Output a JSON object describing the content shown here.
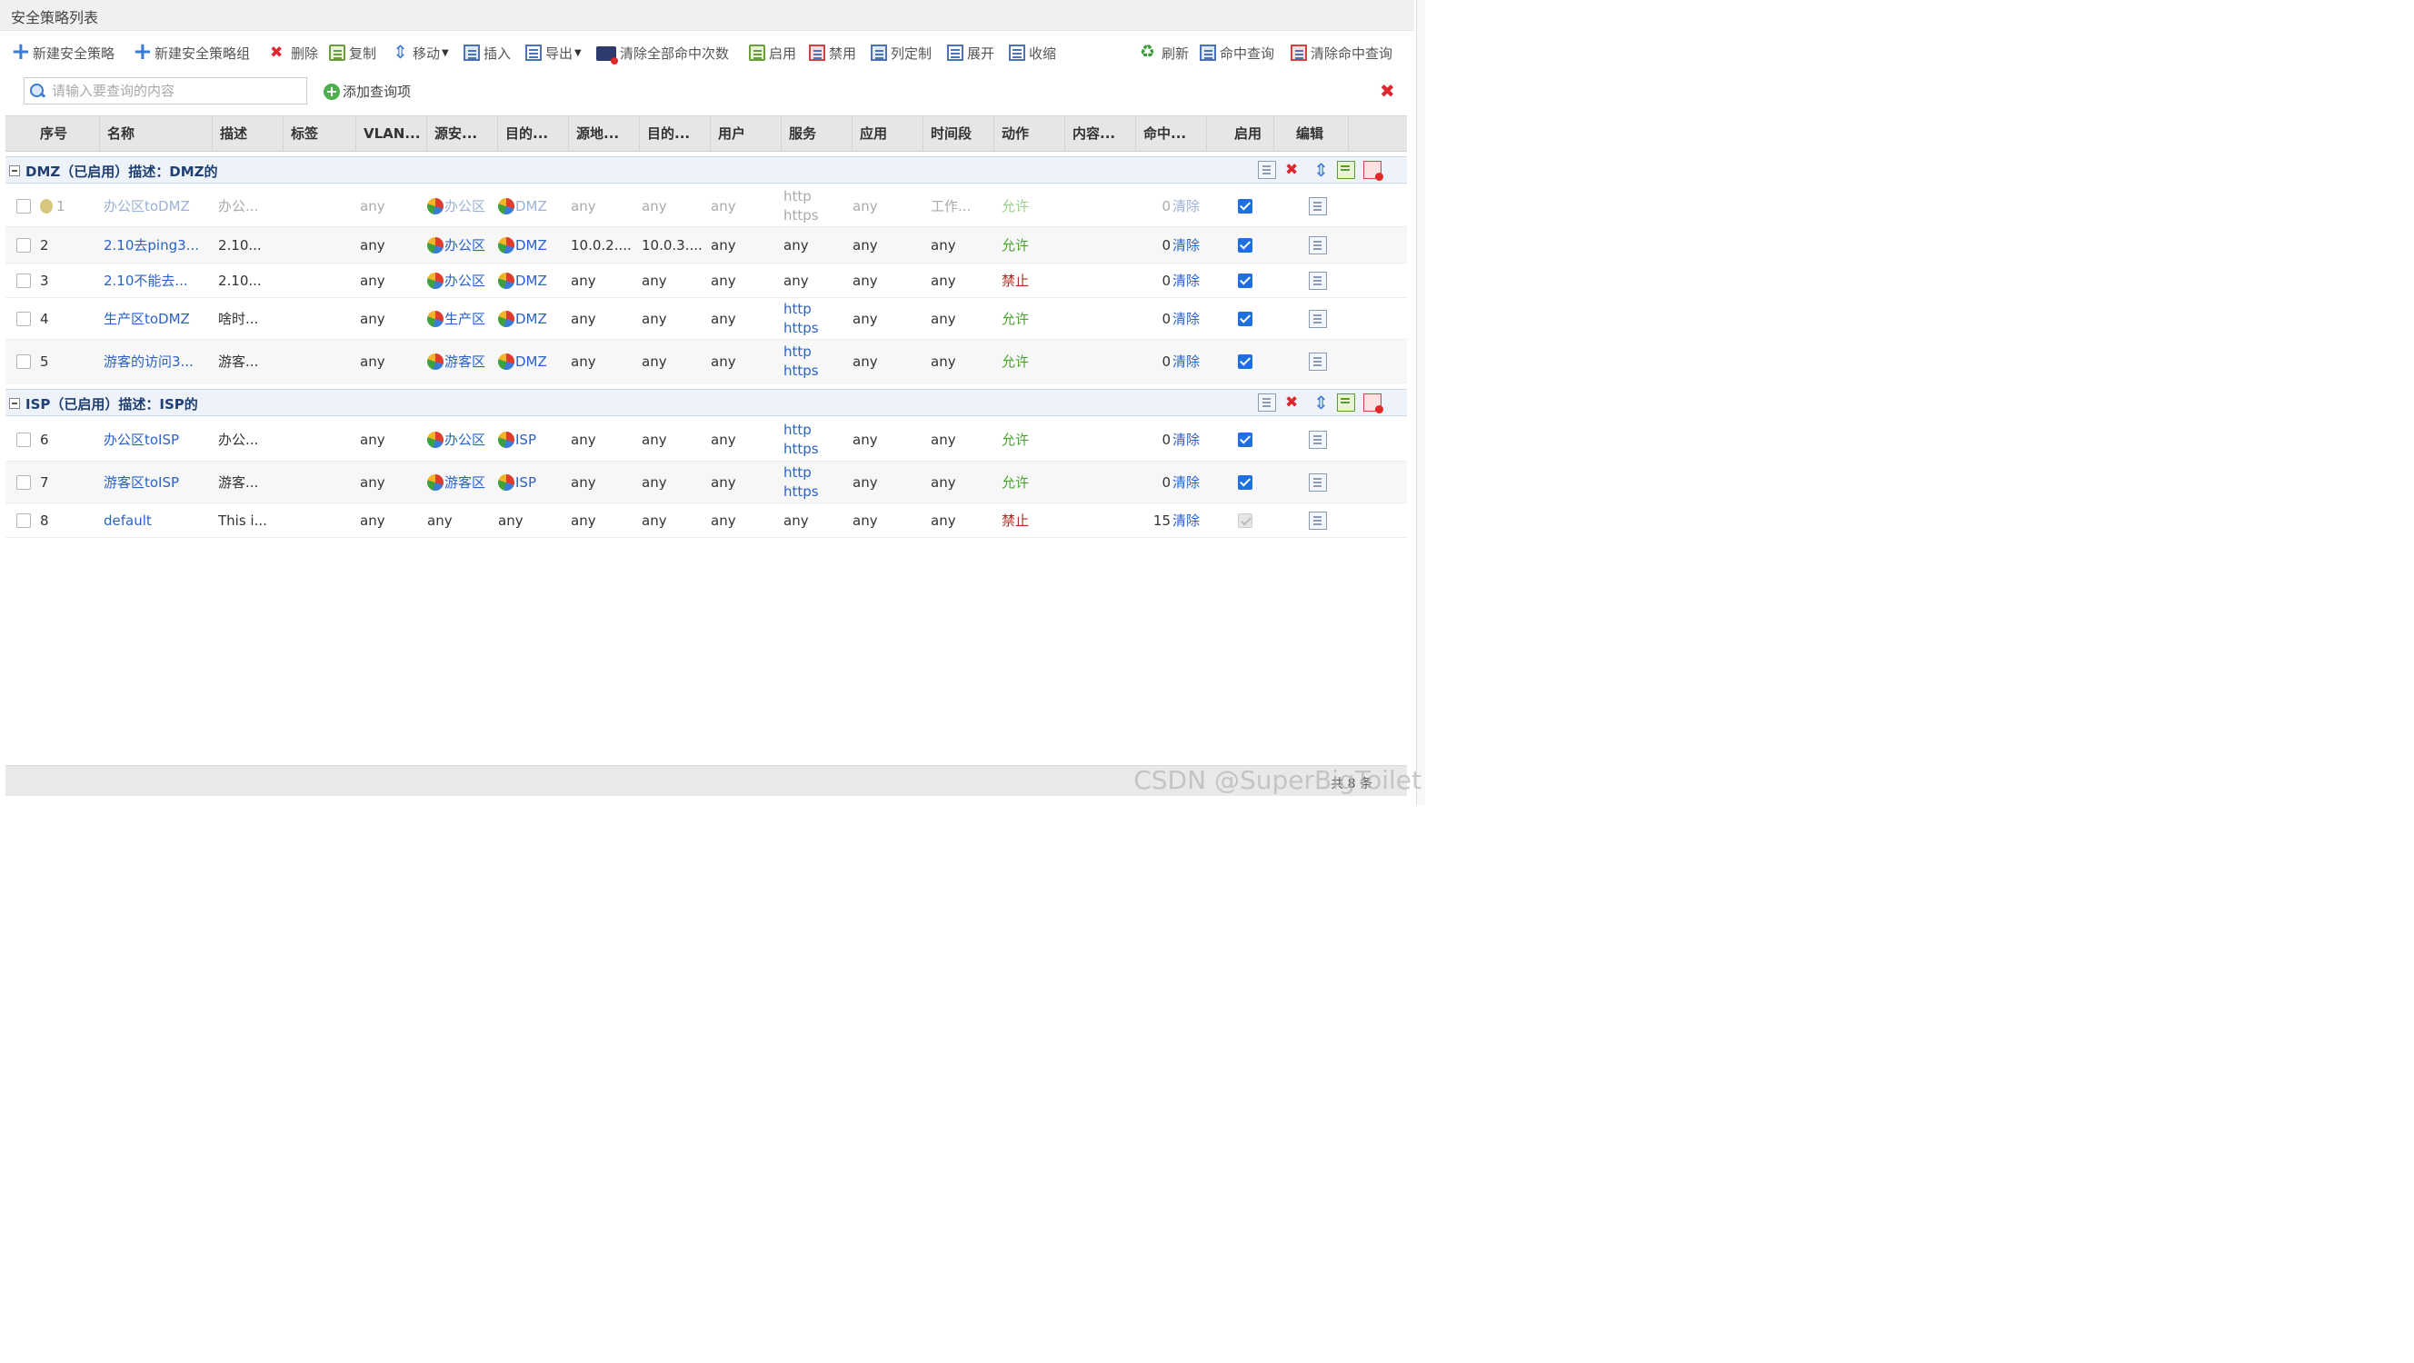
{
  "panel": {
    "title": "安全策略列表"
  },
  "toolbar": {
    "new_policy": "新建安全策略",
    "new_group": "新建安全策略组",
    "delete": "删除",
    "copy": "复制",
    "move": "移动",
    "insert": "插入",
    "export": "导出",
    "clear_all_hits": "清除全部命中次数",
    "enable": "启用",
    "disable": "禁用",
    "customize_columns": "列定制",
    "expand": "展开",
    "collapse": "收缩",
    "refresh": "刷新",
    "hit_query": "命中查询",
    "clear_hit_query": "清除命中查询"
  },
  "search": {
    "placeholder": "请输入要查询的内容",
    "add_query": "添加查询项"
  },
  "columns": [
    "序号",
    "名称",
    "描述",
    "标签",
    "VLAN...",
    "源安...",
    "目的...",
    "源地...",
    "目的...",
    "用户",
    "服务",
    "应用",
    "时间段",
    "动作",
    "内容...",
    "命中...",
    "启用",
    "编辑"
  ],
  "groups": [
    {
      "label": "DMZ（已启用）描述：DMZ的"
    },
    {
      "label": "ISP（已启用）描述：ISP的"
    }
  ],
  "rows": [
    {
      "seq": "1",
      "name": "办公区toDMZ",
      "desc": "办公...",
      "vlan": "any",
      "src_zone": "办公区",
      "dst_zone": "DMZ",
      "src_addr": "any",
      "dst_addr": "any",
      "user": "any",
      "service": [
        "http",
        "https"
      ],
      "app": "any",
      "time": "工作...",
      "action": "允许",
      "hits": "0",
      "clear": "清除",
      "enabled": true
    },
    {
      "seq": "2",
      "name": "2.10去ping3...",
      "desc": "2.10...",
      "vlan": "any",
      "src_zone": "办公区",
      "dst_zone": "DMZ",
      "src_addr": "10.0.2....",
      "dst_addr": "10.0.3....",
      "user": "any",
      "service": [
        "any"
      ],
      "app": "any",
      "time": "any",
      "action": "允许",
      "hits": "0",
      "clear": "清除",
      "enabled": true
    },
    {
      "seq": "3",
      "name": "2.10不能去...",
      "desc": "2.10...",
      "vlan": "any",
      "src_zone": "办公区",
      "dst_zone": "DMZ",
      "src_addr": "any",
      "dst_addr": "any",
      "user": "any",
      "service": [
        "any"
      ],
      "app": "any",
      "time": "any",
      "action": "禁止",
      "hits": "0",
      "clear": "清除",
      "enabled": true
    },
    {
      "seq": "4",
      "name": "生产区toDMZ",
      "desc": "啥时...",
      "vlan": "any",
      "src_zone": "生产区",
      "dst_zone": "DMZ",
      "src_addr": "any",
      "dst_addr": "any",
      "user": "any",
      "service": [
        "http",
        "https"
      ],
      "app": "any",
      "time": "any",
      "action": "允许",
      "hits": "0",
      "clear": "清除",
      "enabled": true
    },
    {
      "seq": "5",
      "name": "游客的访问3...",
      "desc": "游客...",
      "vlan": "any",
      "src_zone": "游客区",
      "dst_zone": "DMZ",
      "src_addr": "any",
      "dst_addr": "any",
      "user": "any",
      "service": [
        "http",
        "https"
      ],
      "app": "any",
      "time": "any",
      "action": "允许",
      "hits": "0",
      "clear": "清除",
      "enabled": true
    },
    {
      "seq": "6",
      "name": "办公区toISP",
      "desc": "办公...",
      "vlan": "any",
      "src_zone": "办公区",
      "dst_zone": "ISP",
      "src_addr": "any",
      "dst_addr": "any",
      "user": "any",
      "service": [
        "http",
        "https"
      ],
      "app": "any",
      "time": "any",
      "action": "允许",
      "hits": "0",
      "clear": "清除",
      "enabled": true
    },
    {
      "seq": "7",
      "name": "游客区toISP",
      "desc": "游客...",
      "vlan": "any",
      "src_zone": "游客区",
      "dst_zone": "ISP",
      "src_addr": "any",
      "dst_addr": "any",
      "user": "any",
      "service": [
        "http",
        "https"
      ],
      "app": "any",
      "time": "any",
      "action": "允许",
      "hits": "0",
      "clear": "清除",
      "enabled": true
    },
    {
      "seq": "8",
      "name": "default",
      "desc": "This i...",
      "vlan": "any",
      "src_zone": "any",
      "dst_zone": "any",
      "src_addr": "any",
      "dst_addr": "any",
      "user": "any",
      "service": [
        "any"
      ],
      "app": "any",
      "time": "any",
      "action": "禁止",
      "hits": "15",
      "clear": "清除",
      "enabled": false
    }
  ],
  "footer": {
    "summary": "共 8 条"
  },
  "watermark": "CSDN @SuperBigToilet",
  "colors": {
    "accent": "#2a62c9",
    "allow": "#4aa32c",
    "deny": "#b3261e",
    "header_bg": "#e6e6e6",
    "group_bg": "#eef3fa"
  }
}
